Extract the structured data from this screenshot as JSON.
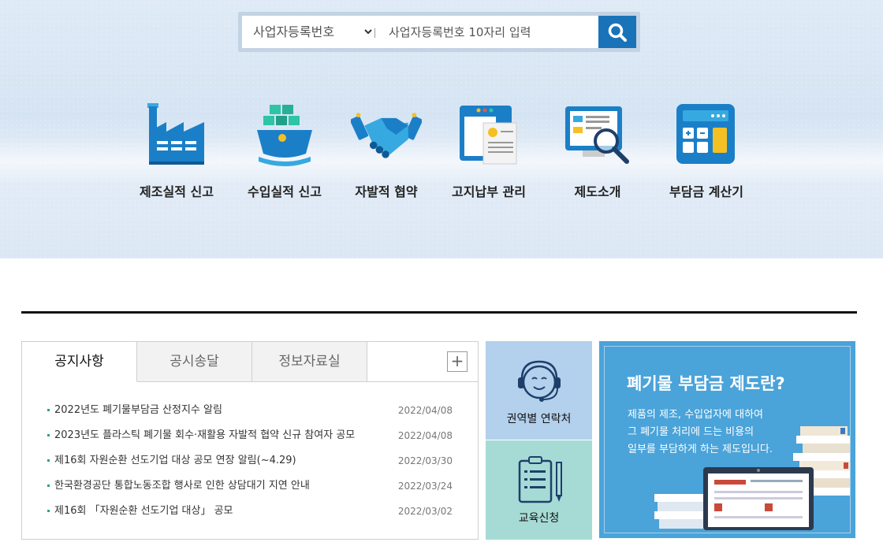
{
  "search": {
    "select_label": "사업자등록번호",
    "placeholder": "사업자등록번호 10자리 입력"
  },
  "menu": [
    {
      "label": "제조실적 신고",
      "icon": "factory-icon"
    },
    {
      "label": "수입실적 신고",
      "icon": "cargo-ship-icon"
    },
    {
      "label": "자발적 협약",
      "icon": "handshake-icon"
    },
    {
      "label": "고지납부 관리",
      "icon": "bill-document-icon"
    },
    {
      "label": "제도소개",
      "icon": "monitor-magnifier-icon"
    },
    {
      "label": "부담금 계산기",
      "icon": "calculator-icon"
    }
  ],
  "board": {
    "tabs": [
      "공지사항",
      "공시송달",
      "정보자료실"
    ],
    "active_tab": "공지사항",
    "more_label": "+",
    "notices": [
      {
        "title": "2022년도 폐기물부담금 산정지수 알림",
        "date": "2022/04/08"
      },
      {
        "title": "2023년도 플라스틱 폐기물 회수·재활용 자발적 협약 신규 참여자 공모",
        "date": "2022/04/08"
      },
      {
        "title": "제16회 자원순환 선도기업 대상 공모 연장 알림(~4.29)",
        "date": "2022/03/30"
      },
      {
        "title": "한국환경공단 통합노동조합 행사로 인한 상담대기 지연 안내",
        "date": "2022/03/24"
      },
      {
        "title": "제16회 「자원순환 선도기업 대상」 공모",
        "date": "2022/03/02"
      }
    ]
  },
  "quick": {
    "contact_label": "권역별 연락처",
    "education_label": "교육신청"
  },
  "banner": {
    "title": "폐기물 부담금 제도란?",
    "desc_lines": [
      "제품의 제조, 수입업자에 대하여",
      "그 폐기물 처리에 드는 비용의",
      "일부를 부담하게 하는 제도입니다."
    ]
  },
  "colors": {
    "accent": "#1a73b8",
    "bullet": "#2ea37f",
    "quick1_bg": "#b3d0ec",
    "quick2_bg": "#a6dbd5",
    "banner_bg": "#4aa3d9"
  }
}
